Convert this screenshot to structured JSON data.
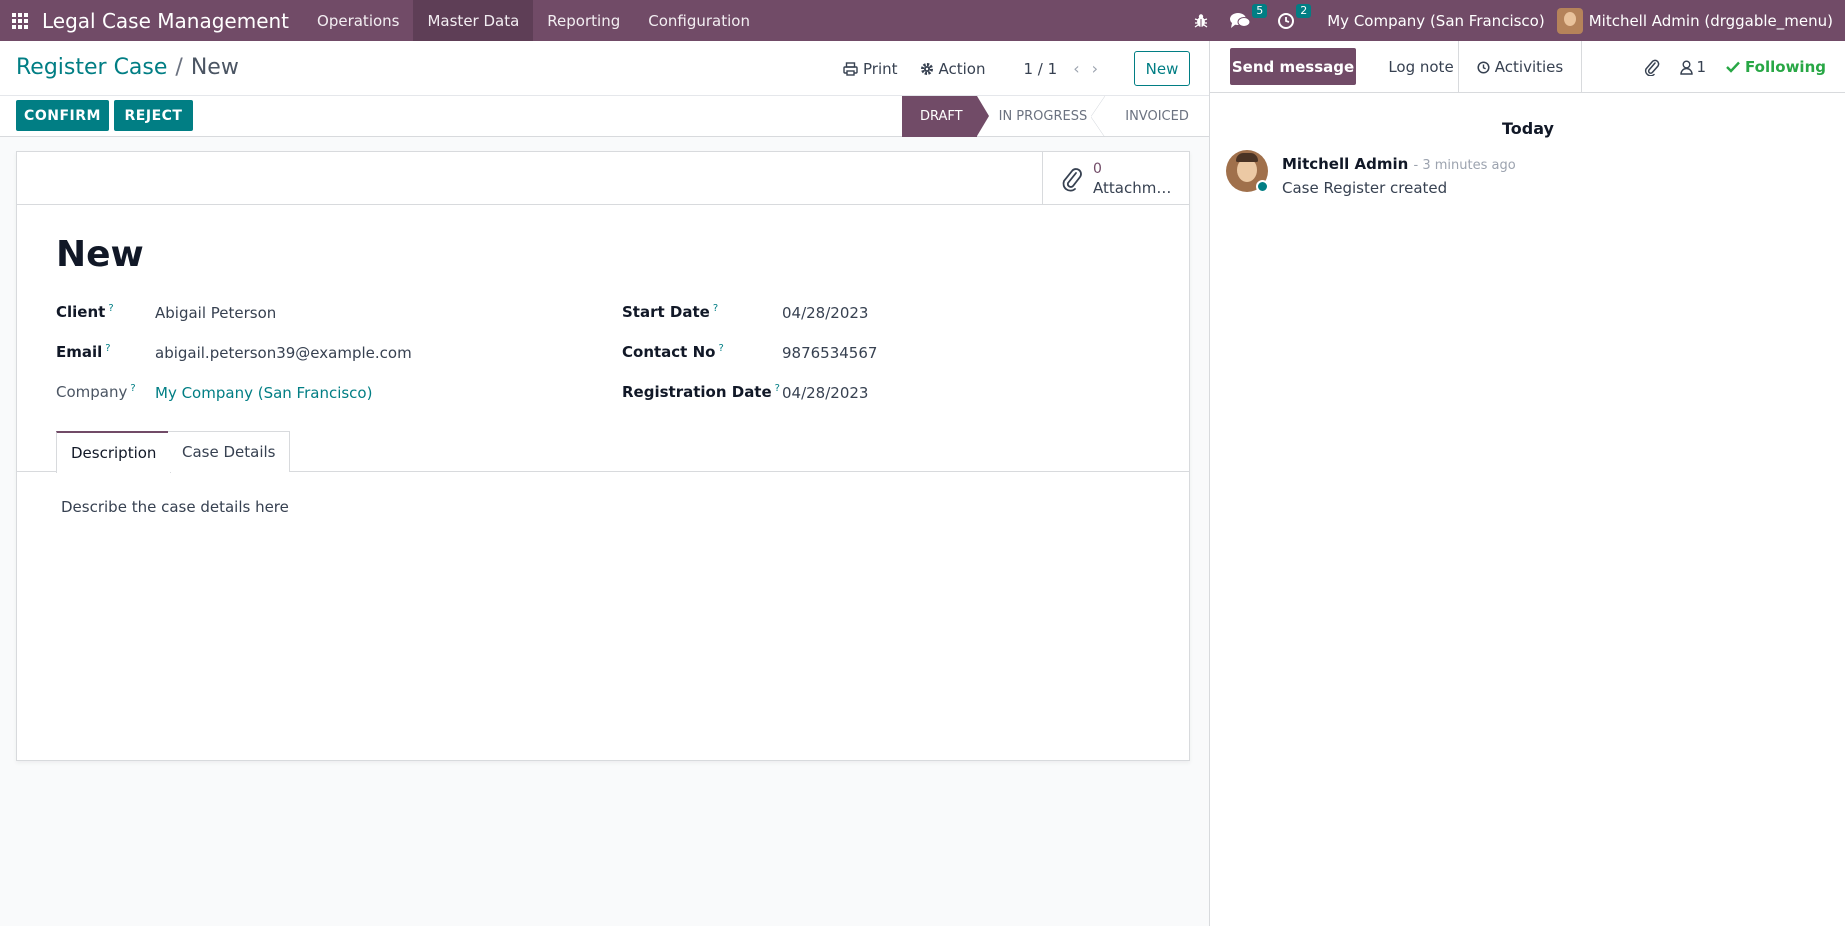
{
  "navbar": {
    "brand": "Legal Case Management",
    "menu": [
      "Operations",
      "Master Data",
      "Reporting",
      "Configuration"
    ],
    "messages_count": "5",
    "activities_count": "2",
    "company": "My Company (San Francisco)",
    "user": "Mitchell Admin (drggable_menu)"
  },
  "control": {
    "breadcrumb_parent": "Register Case",
    "breadcrumb_sep": "/",
    "breadcrumb_current": "New",
    "print_label": "Print",
    "action_label": "Action",
    "pager": "1 / 1",
    "new_label": "New",
    "confirm_label": "CONFIRM",
    "reject_label": "REJECT",
    "stages": [
      "DRAFT",
      "IN PROGRESS",
      "INVOICED"
    ]
  },
  "form": {
    "attachments_count": "0",
    "attachments_label": "Attachm…",
    "title": "New",
    "client_label": "Client",
    "client_value": "Abigail Peterson",
    "email_label": "Email",
    "email_value": "abigail.peterson39@example.com",
    "company_label": "Company",
    "company_value": "My Company (San Francisco)",
    "start_date_label": "Start Date",
    "start_date_value": "04/28/2023",
    "contact_label": "Contact No",
    "contact_value": "9876534567",
    "reg_date_label": "Registration Date",
    "reg_date_value": "04/28/2023",
    "help_mark": "?",
    "tabs": [
      "Description",
      "Case Details"
    ],
    "description": "Describe the case details here"
  },
  "chatter": {
    "send_message": "Send message",
    "log_note": "Log note",
    "activities": "Activities",
    "followers_count": "1",
    "following": "Following",
    "date_separator": "Today",
    "message": {
      "author": "Mitchell Admin",
      "time": "- 3 minutes ago",
      "body": "Case Register created"
    }
  },
  "colors": {
    "brand": "#714B67",
    "accent": "#017e84",
    "success": "#28a745"
  }
}
